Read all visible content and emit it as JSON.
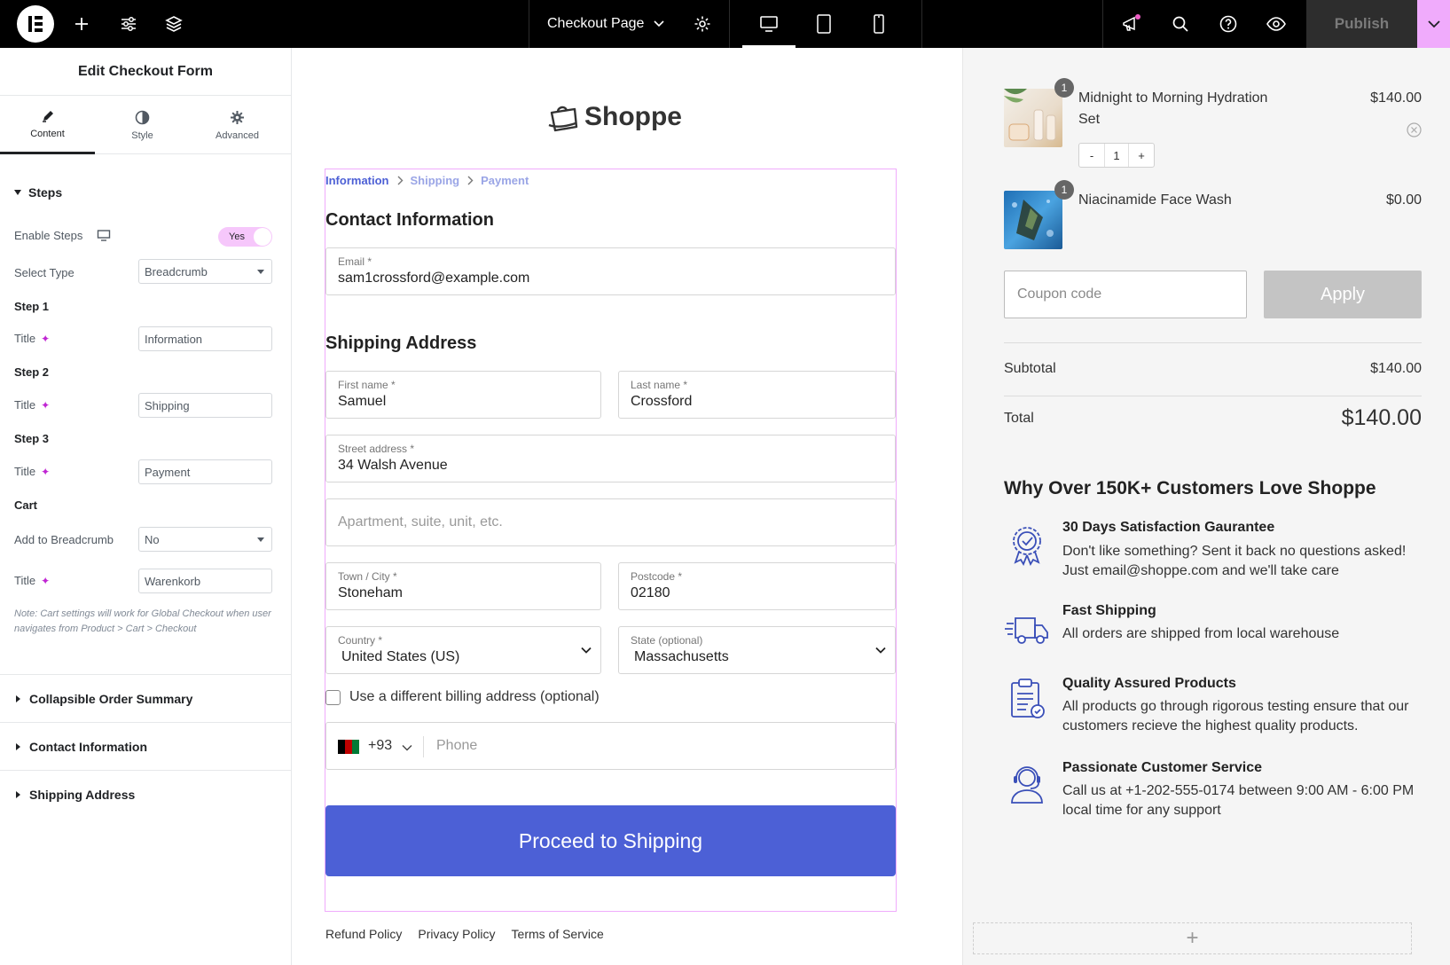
{
  "topbar": {
    "page_title": "Checkout Page",
    "publish_label": "Publish",
    "icons": [
      "elementor-logo-icon",
      "plus-icon",
      "settings-sliders-icon",
      "layers-icon",
      "chevron-down-icon",
      "gear-icon",
      "desktop-icon",
      "tablet-icon",
      "mobile-icon",
      "megaphone-icon",
      "search-icon",
      "help-icon",
      "eye-icon"
    ]
  },
  "panel": {
    "title": "Edit Checkout Form",
    "tabs": [
      {
        "label": "Content",
        "icon": "pencil-icon"
      },
      {
        "label": "Style",
        "icon": "contrast-icon"
      },
      {
        "label": "Advanced",
        "icon": "gear-icon"
      }
    ],
    "section_steps": "Steps",
    "enable_steps_label": "Enable Steps",
    "enable_steps_value": "Yes",
    "select_type_label": "Select Type",
    "select_type_value": "Breadcrumb",
    "step1_label": "Step 1",
    "step2_label": "Step 2",
    "step3_label": "Step 3",
    "title_label": "Title",
    "step1_title": "Information",
    "step2_title": "Shipping",
    "step3_title": "Payment",
    "cart_label": "Cart",
    "add_breadcrumb_label": "Add to Breadcrumb",
    "add_breadcrumb_value": "No",
    "cart_title": "Warenkorb",
    "note": "Note: Cart settings will work for Global Checkout when user navigates from Product > Cart > Checkout",
    "accordions": [
      "Collapsible Order Summary",
      "Contact Information",
      "Shipping Address"
    ]
  },
  "checkout": {
    "brand": "Shoppe",
    "breadcrumb": [
      "Information",
      "Shipping",
      "Payment"
    ],
    "contact_heading": "Contact Information",
    "email_label": "Email *",
    "email_value": "sam1crossford@example.com",
    "shipping_heading": "Shipping Address",
    "first_name_label": "First name *",
    "first_name_value": "Samuel",
    "last_name_label": "Last name *",
    "last_name_value": "Crossford",
    "street_label": "Street address *",
    "street_value": "34 Walsh Avenue",
    "apartment_placeholder": "Apartment, suite, unit, etc.",
    "city_label": "Town / City *",
    "city_value": "Stoneham",
    "postcode_label": "Postcode *",
    "postcode_value": "02180",
    "country_label": "Country *",
    "country_value": "United States (US)",
    "state_label": "State (optional)",
    "state_value": "Massachusetts",
    "billing_label": "Use a different billing address (optional)",
    "phone_code": "+93",
    "phone_placeholder": "Phone",
    "proceed_label": "Proceed to Shipping",
    "footer_links": [
      "Refund Policy",
      "Privacy Policy",
      "Terms of Service"
    ]
  },
  "summary": {
    "items": [
      {
        "qty": "1",
        "name": "Midnight to Morning Hydration Set",
        "price": "$140.00",
        "stepper_qty": "1"
      },
      {
        "qty": "1",
        "name": "Niacinamide Face Wash",
        "price": "$0.00"
      }
    ],
    "stepper_minus": "-",
    "stepper_plus": "+",
    "coupon_placeholder": "Coupon code",
    "apply_label": "Apply",
    "subtotal_label": "Subtotal",
    "subtotal_value": "$140.00",
    "total_label": "Total",
    "total_value": "$140.00",
    "why_heading": "Why Over 150K+ Customers Love Shoppe",
    "features": [
      {
        "title": "30 Days Satisfaction Gaurantee",
        "desc": "Don't like something? Sent it back no questions asked! Just email@shoppe.com and we'll take care",
        "icon": "award-badge-icon"
      },
      {
        "title": "Fast Shipping",
        "desc": "All orders are shipped from local warehouse",
        "icon": "delivery-truck-icon"
      },
      {
        "title": "Quality Assured Products",
        "desc": "All products go through rigorous testing ensure that our customers recieve the highest quality products.",
        "icon": "clipboard-check-icon"
      },
      {
        "title": "Passionate Customer Service",
        "desc": "Call us at +1-202-555-0174 between 9:00 AM - 6:00 PM local time for any support",
        "icon": "support-agent-icon"
      }
    ],
    "add_section_symbol": "+"
  },
  "colors": {
    "accent_pink": "#f0abfc",
    "button_blue": "#4c60d6",
    "breadcrumb_active": "#4c5fd5",
    "breadcrumb_inactive": "#9aa5e6"
  }
}
